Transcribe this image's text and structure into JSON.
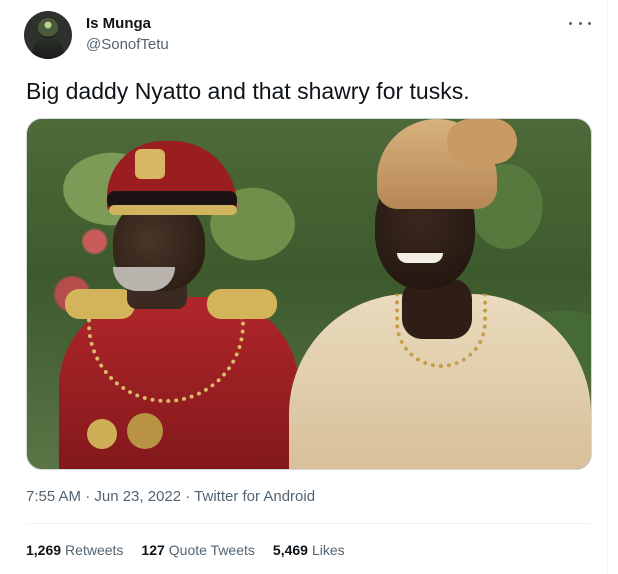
{
  "tweet": {
    "author_name": "Is Munga",
    "handle": "@SonofTetu",
    "text": "Big daddy Nyatto and that shawry for tusks.",
    "timestamp": "7:55 AM · Jun 23, 2022 · Twitter for Android",
    "stats": {
      "retweets_count": "1,269",
      "retweets_label": "Retweets",
      "quote_tweets_count": "127",
      "quote_tweets_label": "Quote Tweets",
      "likes_count": "5,469",
      "likes_label": "Likes"
    }
  },
  "colors": {
    "text_primary": "#0f1419",
    "text_secondary": "#536471",
    "divider": "#eff3f4"
  },
  "icons": {
    "more": "more-icon"
  }
}
